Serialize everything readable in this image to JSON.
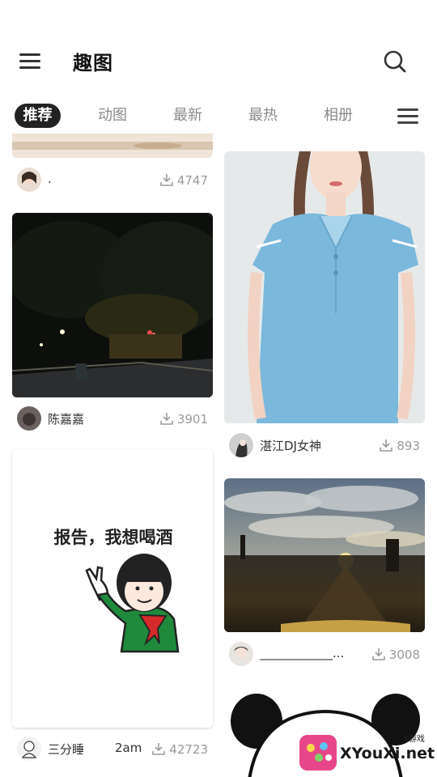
{
  "header": {
    "title": "趣图"
  },
  "tabs": [
    {
      "label": "推荐",
      "active": true
    },
    {
      "label": "动图",
      "active": false
    },
    {
      "label": "最新",
      "active": false
    },
    {
      "label": "最热",
      "active": false
    },
    {
      "label": "相册",
      "active": false
    }
  ],
  "feed": {
    "left": [
      {
        "user": ".",
        "downloads": "4747"
      },
      {
        "user": "陈嘉嘉",
        "downloads": "3901"
      },
      {
        "user": "三分睡",
        "time": "2am",
        "downloads": "42723",
        "meme_text": "报告，我想喝酒"
      }
    ],
    "right": [
      {
        "user": "湛江DJ女神",
        "downloads": "893"
      },
      {
        "user": "____________...",
        "downloads": "3008"
      }
    ]
  },
  "watermark": {
    "text": "XYouXi.net",
    "sub": "X游戏"
  },
  "colors": {
    "active_tab_bg": "#222222",
    "inactive_tab_text": "#8a8a8a",
    "download_text": "#9a9a9a"
  }
}
